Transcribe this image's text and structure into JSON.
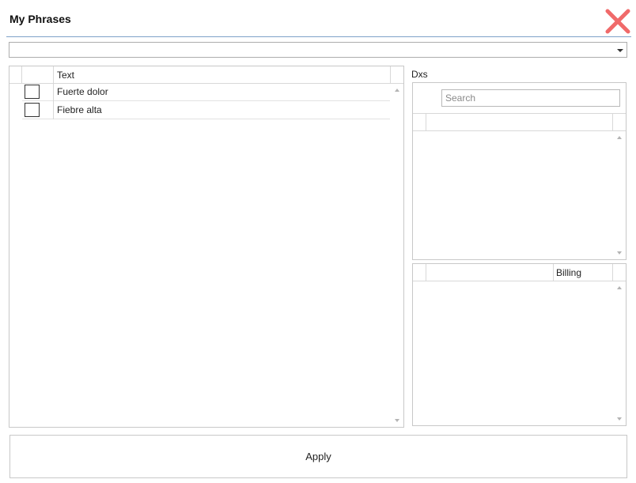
{
  "window": {
    "title": "My Phrases",
    "close_icon": "close-icon",
    "close_color": "#f06a6a"
  },
  "category_dropdown": {
    "selected": ""
  },
  "phrases_grid": {
    "columns": [
      "",
      "",
      "Text"
    ],
    "rows": [
      {
        "checked": false,
        "text": "Fuerte dolor"
      },
      {
        "checked": false,
        "text": "Fiebre alta"
      }
    ]
  },
  "dxs": {
    "label": "Dxs",
    "search_placeholder": "Search"
  },
  "billing_grid": {
    "columns": [
      "",
      "",
      "Billing"
    ]
  },
  "apply": {
    "label": "Apply"
  }
}
